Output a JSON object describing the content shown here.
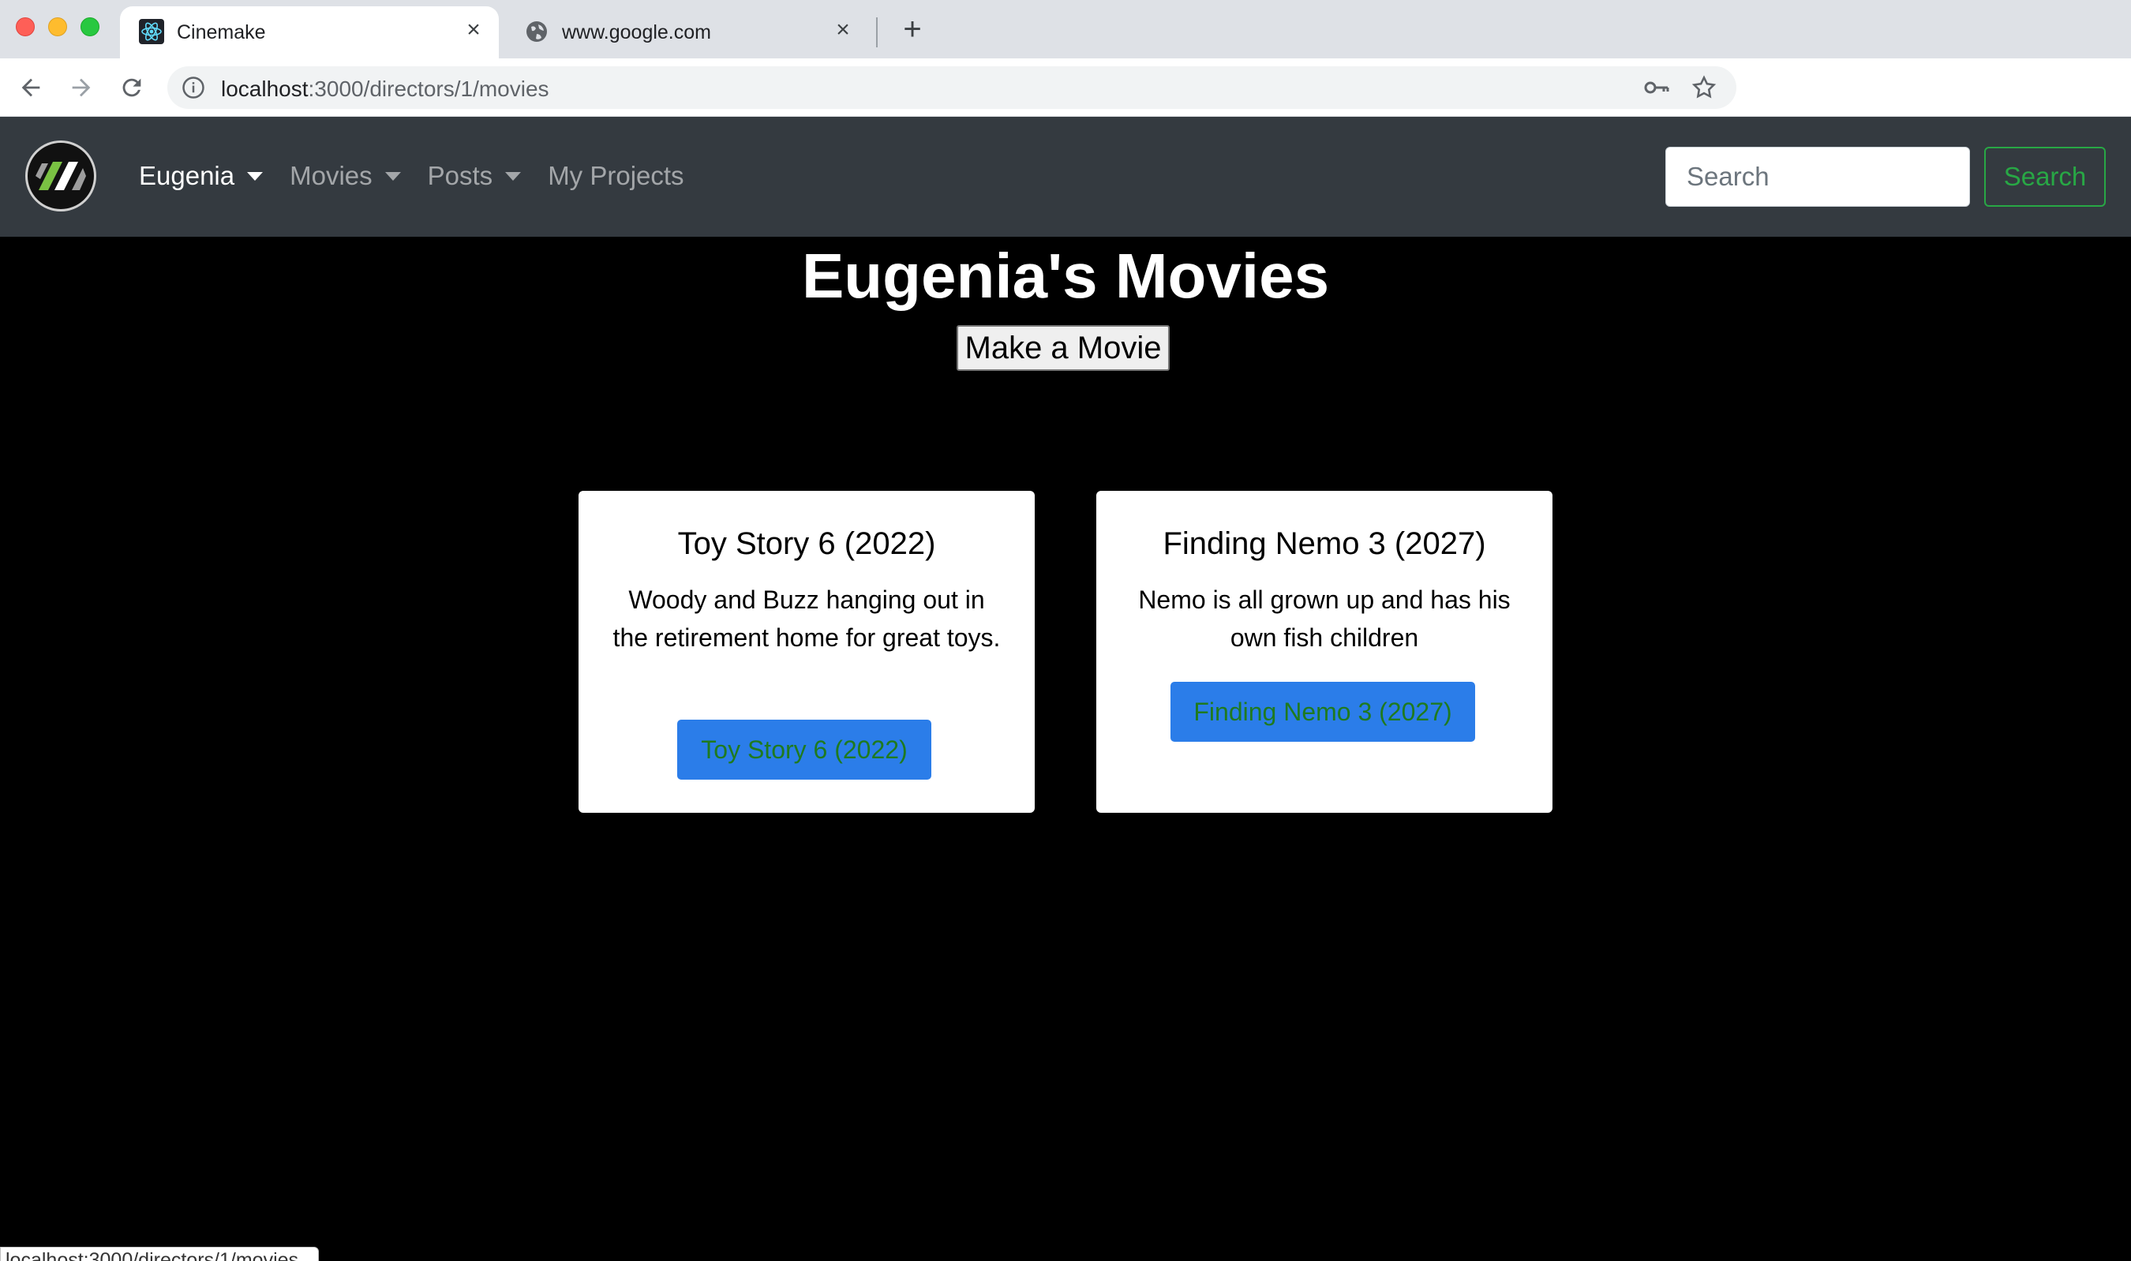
{
  "browser": {
    "tabs": [
      {
        "title": "Cinemake",
        "active": true,
        "icon": "react-atom-icon"
      },
      {
        "title": "www.google.com",
        "active": false,
        "icon": "globe-icon"
      }
    ],
    "url_host": "localhost",
    "url_path": ":3000/directors/1/movies",
    "status_url": "localhost:3000/directors/1/movies"
  },
  "navbar": {
    "links": [
      {
        "label": "Eugenia",
        "dropdown": true,
        "active": true
      },
      {
        "label": "Movies",
        "dropdown": true,
        "active": false
      },
      {
        "label": "Posts",
        "dropdown": true,
        "active": false
      },
      {
        "label": "My Projects",
        "dropdown": false,
        "active": false
      }
    ],
    "search_placeholder": "Search",
    "search_button": "Search"
  },
  "page": {
    "title": "Eugenia's Movies",
    "make_button": "Make a Movie"
  },
  "movies": [
    {
      "title": "Toy Story 6 (2022)",
      "description": "Woody and Buzz hanging out in the retirement home for great toys.",
      "button": "Toy Story 6 (2022)"
    },
    {
      "title": "Finding Nemo 3 (2027)",
      "description": "Nemo is all grown up and has his own fish children",
      "button": "Finding Nemo 3 (2027)"
    }
  ],
  "colors": {
    "navbar_bg": "#343a40",
    "success": "#28a745",
    "card_button": "#2b7de9",
    "page_bg": "#000000"
  }
}
